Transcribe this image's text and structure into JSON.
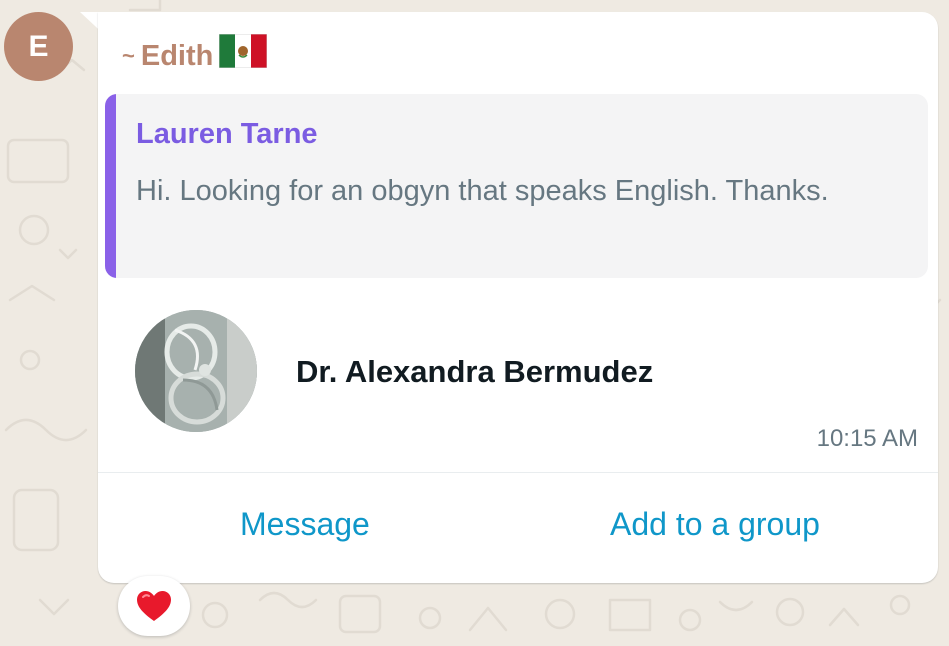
{
  "chat": {
    "sender": {
      "initial": "E",
      "prefix": "~",
      "name": "Edith",
      "flag_icon": "mexico-flag-icon",
      "color": "#b9866f"
    },
    "quoted_message": {
      "author": "Lauren Tarne",
      "text": "Hi. Looking for an obgyn that speaks English. Thanks.",
      "accent_color": "#8a61e8"
    },
    "contact_card": {
      "photo_icon": "contact-photo",
      "name": "Dr. Alexandra Bermudez",
      "time": "10:15 AM"
    },
    "actions": {
      "message_label": "Message",
      "add_to_group_label": "Add to a group",
      "color": "#0f97c9"
    },
    "reaction": {
      "emoji_icon": "red-heart-icon"
    }
  }
}
